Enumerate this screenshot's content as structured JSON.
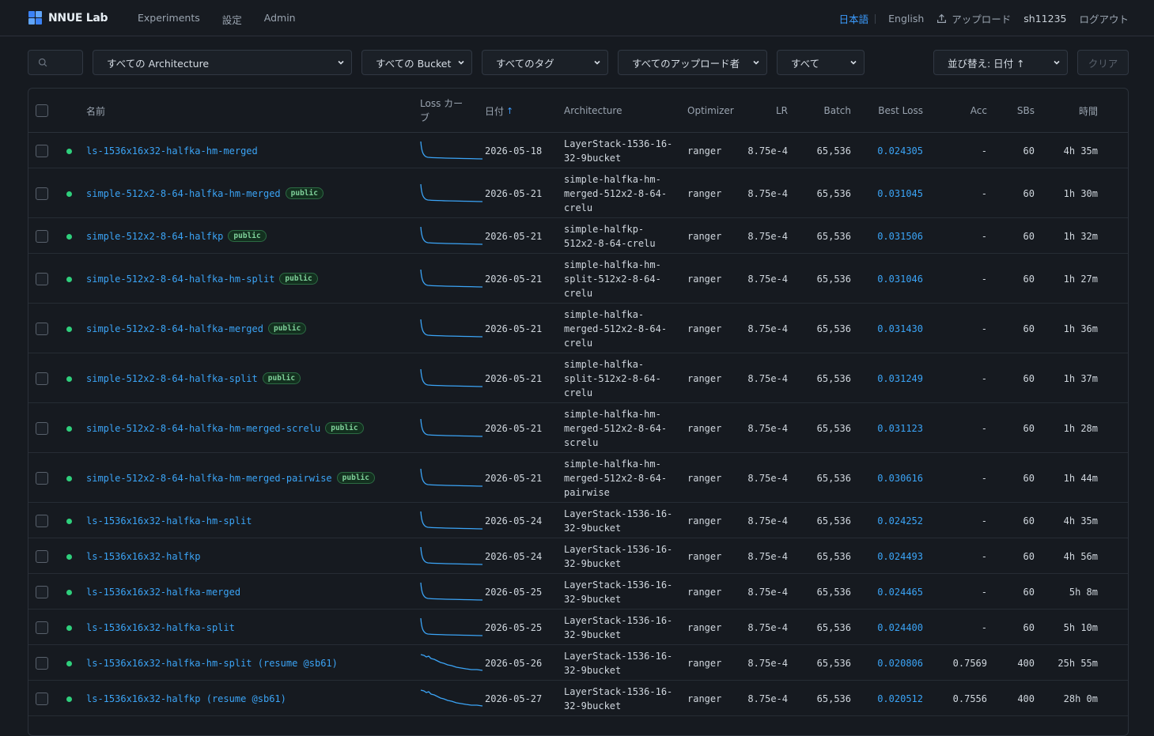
{
  "brand": {
    "name": "NNUE Lab",
    "colors": [
      "#3b82f6",
      "#2fcf7c",
      "#f59e0b",
      "#3b82f6"
    ]
  },
  "nav": {
    "experiments": "Experiments",
    "settings": "設定",
    "admin": "Admin"
  },
  "header_right": {
    "lang_ja": "日本語",
    "lang_en": "English",
    "upload": "アップロード",
    "user": "sh11235",
    "logout": "ログアウト"
  },
  "filters": {
    "architecture": "すべての Architecture",
    "bucket": "すべての Bucket",
    "tag": "すべてのタグ",
    "uploader": "すべてのアップロード者",
    "status": "すべて",
    "sort": "並び替え: 日付 ↑",
    "clear": "クリア"
  },
  "columns": {
    "name": "名前",
    "loss_curve": "Loss カーブ",
    "date": "日付",
    "date_arrow": "↑",
    "architecture": "Architecture",
    "optimizer": "Optimizer",
    "lr": "LR",
    "batch": "Batch",
    "best_loss": "Best Loss",
    "acc": "Acc",
    "sbs": "SBs",
    "time": "時間"
  },
  "badge_label": "public",
  "rows": [
    {
      "name": "ls-1536x16x32-halfka-hm-merged",
      "public": false,
      "date": "2026-05-18",
      "arch": "LayerStack-1536-16-\n32-9bucket",
      "opt": "ranger",
      "lr": "8.75e-4",
      "batch": "65,536",
      "loss": "0.024305",
      "acc": "-",
      "sbs": "60",
      "time": "4h 35m",
      "curve": "steep"
    },
    {
      "name": "simple-512x2-8-64-halfka-hm-merged",
      "public": true,
      "date": "2026-05-21",
      "arch": "simple-halfka-hm-\nmerged-512x2-8-64-\ncrelu",
      "opt": "ranger",
      "lr": "8.75e-4",
      "batch": "65,536",
      "loss": "0.031045",
      "acc": "-",
      "sbs": "60",
      "time": "1h 30m",
      "curve": "steep"
    },
    {
      "name": "simple-512x2-8-64-halfkp",
      "public": true,
      "date": "2026-05-21",
      "arch": "simple-halfkp-\n512x2-8-64-crelu",
      "opt": "ranger",
      "lr": "8.75e-4",
      "batch": "65,536",
      "loss": "0.031506",
      "acc": "-",
      "sbs": "60",
      "time": "1h 32m",
      "curve": "steep"
    },
    {
      "name": "simple-512x2-8-64-halfka-hm-split",
      "public": true,
      "date": "2026-05-21",
      "arch": "simple-halfka-hm-\nsplit-512x2-8-64-\ncrelu",
      "opt": "ranger",
      "lr": "8.75e-4",
      "batch": "65,536",
      "loss": "0.031046",
      "acc": "-",
      "sbs": "60",
      "time": "1h 27m",
      "curve": "steep"
    },
    {
      "name": "simple-512x2-8-64-halfka-merged",
      "public": true,
      "date": "2026-05-21",
      "arch": "simple-halfka-\nmerged-512x2-8-64-\ncrelu",
      "opt": "ranger",
      "lr": "8.75e-4",
      "batch": "65,536",
      "loss": "0.031430",
      "acc": "-",
      "sbs": "60",
      "time": "1h 36m",
      "curve": "steep"
    },
    {
      "name": "simple-512x2-8-64-halfka-split",
      "public": true,
      "date": "2026-05-21",
      "arch": "simple-halfka-\nsplit-512x2-8-64-\ncrelu",
      "opt": "ranger",
      "lr": "8.75e-4",
      "batch": "65,536",
      "loss": "0.031249",
      "acc": "-",
      "sbs": "60",
      "time": "1h 37m",
      "curve": "steep"
    },
    {
      "name": "simple-512x2-8-64-halfka-hm-merged-screlu",
      "public": true,
      "date": "2026-05-21",
      "arch": "simple-halfka-hm-\nmerged-512x2-8-64-\nscrelu",
      "opt": "ranger",
      "lr": "8.75e-4",
      "batch": "65,536",
      "loss": "0.031123",
      "acc": "-",
      "sbs": "60",
      "time": "1h 28m",
      "curve": "steep"
    },
    {
      "name": "simple-512x2-8-64-halfka-hm-merged-pairwise",
      "public": true,
      "date": "2026-05-21",
      "arch": "simple-halfka-hm-\nmerged-512x2-8-64-\npairwise",
      "opt": "ranger",
      "lr": "8.75e-4",
      "batch": "65,536",
      "loss": "0.030616",
      "acc": "-",
      "sbs": "60",
      "time": "1h 44m",
      "curve": "steep"
    },
    {
      "name": "ls-1536x16x32-halfka-hm-split",
      "public": false,
      "date": "2026-05-24",
      "arch": "LayerStack-1536-16-\n32-9bucket",
      "opt": "ranger",
      "lr": "8.75e-4",
      "batch": "65,536",
      "loss": "0.024252",
      "acc": "-",
      "sbs": "60",
      "time": "4h 35m",
      "curve": "steep"
    },
    {
      "name": "ls-1536x16x32-halfkp",
      "public": false,
      "date": "2026-05-24",
      "arch": "LayerStack-1536-16-\n32-9bucket",
      "opt": "ranger",
      "lr": "8.75e-4",
      "batch": "65,536",
      "loss": "0.024493",
      "acc": "-",
      "sbs": "60",
      "time": "4h 56m",
      "curve": "steep"
    },
    {
      "name": "ls-1536x16x32-halfka-merged",
      "public": false,
      "date": "2026-05-25",
      "arch": "LayerStack-1536-16-\n32-9bucket",
      "opt": "ranger",
      "lr": "8.75e-4",
      "batch": "65,536",
      "loss": "0.024465",
      "acc": "-",
      "sbs": "60",
      "time": "5h 8m",
      "curve": "steep"
    },
    {
      "name": "ls-1536x16x32-halfka-split",
      "public": false,
      "date": "2026-05-25",
      "arch": "LayerStack-1536-16-\n32-9bucket",
      "opt": "ranger",
      "lr": "8.75e-4",
      "batch": "65,536",
      "loss": "0.024400",
      "acc": "-",
      "sbs": "60",
      "time": "5h 10m",
      "curve": "steep"
    },
    {
      "name": "ls-1536x16x32-halfka-hm-split (resume @sb61)",
      "public": false,
      "date": "2026-05-26",
      "arch": "LayerStack-1536-16-\n32-9bucket",
      "opt": "ranger",
      "lr": "8.75e-4",
      "batch": "65,536",
      "loss": "0.020806",
      "acc": "0.7569",
      "sbs": "400",
      "time": "25h 55m",
      "curve": "gradual"
    },
    {
      "name": "ls-1536x16x32-halfkp (resume @sb61)",
      "public": false,
      "date": "2026-05-27",
      "arch": "LayerStack-1536-16-\n32-9bucket",
      "opt": "ranger",
      "lr": "8.75e-4",
      "batch": "65,536",
      "loss": "0.020512",
      "acc": "0.7556",
      "sbs": "400",
      "time": "28h 0m",
      "curve": "gradual"
    }
  ]
}
